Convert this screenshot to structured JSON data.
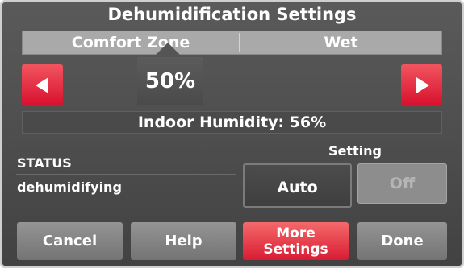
{
  "title": "Dehumidification Settings",
  "zones": {
    "left": "Comfort Zone",
    "right": "Wet"
  },
  "setpoint": "50%",
  "indoor_humidity": "Indoor Humidity: 56%",
  "status": {
    "label": "STATUS",
    "value": "dehumidifying"
  },
  "setting": {
    "label": "Setting",
    "auto": "Auto",
    "off": "Off"
  },
  "buttons": {
    "cancel": "Cancel",
    "help": "Help",
    "more_line1": "More",
    "more_line2": "Settings",
    "done": "Done"
  },
  "icons": {
    "left": "left-arrow-icon",
    "right": "right-arrow-icon"
  },
  "colors": {
    "accent": "#e2233b",
    "background": "#4d4d4d",
    "button_gray": "#858585"
  }
}
